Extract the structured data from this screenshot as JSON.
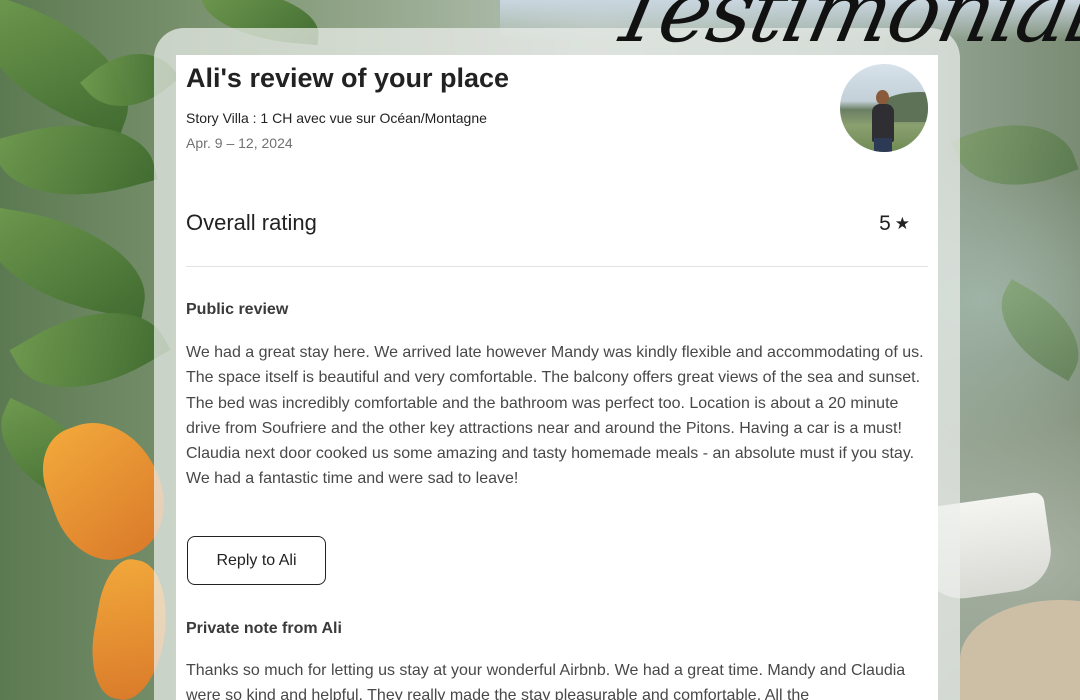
{
  "review": {
    "title": "Ali's review of your place",
    "listing_name": "Story Villa : 1 CH avec vue sur Océan/Montagne",
    "dates": "Apr. 9 – 12, 2024",
    "overall_rating_label": "Overall rating",
    "overall_rating_value": "5",
    "rating_icon": "star-icon",
    "public_review_label": "Public review",
    "public_review_text": "We had a great stay here. We arrived late however Mandy was kindly flexible and accommodating of us. The space itself is beautiful and very comfortable. The balcony offers great views of the sea and sunset. The bed was incredibly comfortable and the bathroom was perfect too. Location is about a 20 minute drive from Soufriere and the other key attractions near and around the Pitons. Having a car is a must! Claudia next door cooked us some amazing and tasty homemade meals - an absolute must if you stay. We had a fantastic time and were sad to leave!",
    "reply_button_label": "Reply to Ali",
    "private_note_label": "Private note from Ali",
    "private_note_text": "Thanks so much for letting us stay at your wonderful Airbnb. We had a great time. Mandy and Claudia were so kind and helpful. They really made the stay pleasurable and comfortable. All the"
  },
  "overlay": {
    "script_title": "Testimonial"
  }
}
